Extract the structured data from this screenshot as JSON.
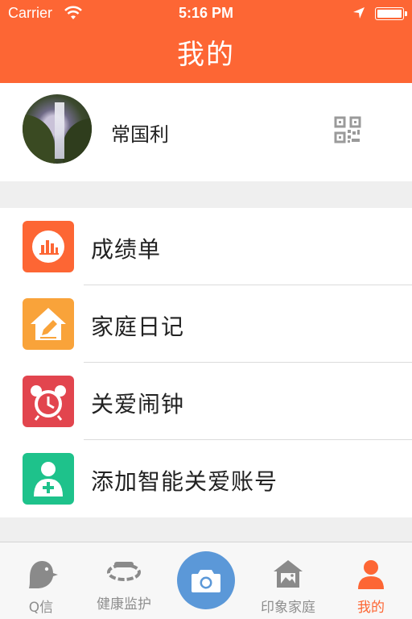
{
  "status_bar": {
    "carrier": "Carrier",
    "time": "5:16 PM"
  },
  "header": {
    "title": "我的",
    "color": "#fd6634"
  },
  "profile": {
    "username": "常国利",
    "avatar_icon": "avatar-photo",
    "qr_icon": "qr-code-icon"
  },
  "menu": {
    "items": [
      {
        "label": "成绩单",
        "icon": "report-chart-icon",
        "color": "#fd6634"
      },
      {
        "label": "家庭日记",
        "icon": "home-diary-icon",
        "color": "#f9a33a"
      },
      {
        "label": "关爱闹钟",
        "icon": "alarm-clock-icon",
        "color": "#e2454e"
      },
      {
        "label": "添加智能关爱账号",
        "icon": "add-account-icon",
        "color": "#1ec28b"
      }
    ]
  },
  "tabbar": {
    "tabs": [
      {
        "label": "Q信",
        "icon": "bird-chat-icon"
      },
      {
        "label": "健康监护",
        "icon": "wristband-icon"
      },
      {
        "label": "印象家庭",
        "icon": "family-photo-icon"
      },
      {
        "label": "我的",
        "icon": "person-icon",
        "active": true
      }
    ],
    "center_icon": "camera-icon",
    "center_color": "#5b98d8"
  }
}
